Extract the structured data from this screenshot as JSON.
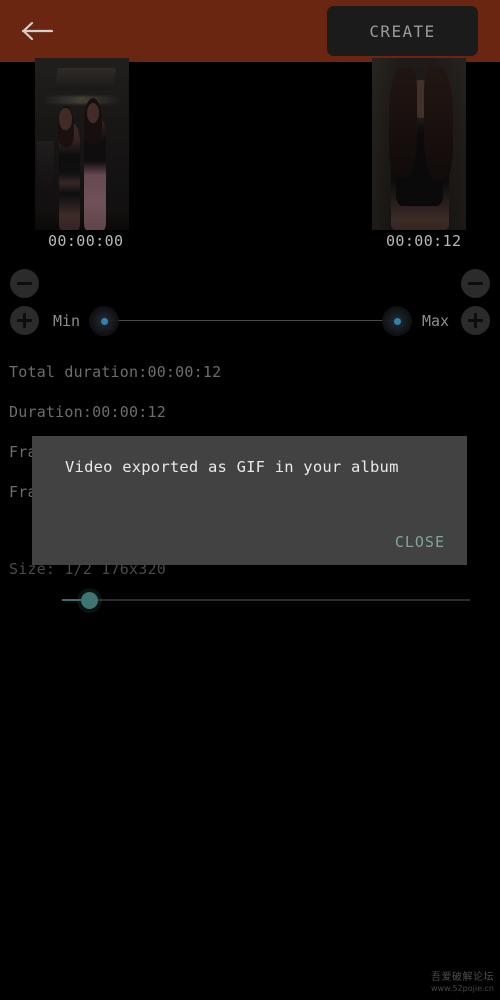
{
  "topbar": {
    "background_color": "#6a2610",
    "back_icon": "back-arrow-icon",
    "create_label": "CREATE"
  },
  "preview": {
    "start_thumbnail_alt": "gym-scene-thumbnail",
    "end_thumbnail_alt": "portrait-thumbnail",
    "start_time": "00:00:00",
    "end_time": "00:00:12"
  },
  "trim_controls": {
    "minus_left_label": "−",
    "plus_left_label": "+",
    "minus_right_label": "−",
    "plus_right_label": "+",
    "min_label": "Min",
    "max_label": "Max",
    "range_min_percent": 0,
    "range_max_percent": 100,
    "handle_color": "#2f82ad"
  },
  "info": {
    "total_duration": "Total duration:00:00:12",
    "duration": "Duration:00:00:12",
    "frame_rate_partial": "Fra",
    "frames_partial": "Fra",
    "size": "Size:  1/2  176x320"
  },
  "quality_slider": {
    "value_percent": 7,
    "accent_color": "#3d7570"
  },
  "dialog": {
    "message": "Video exported as GIF in your album",
    "close_label": "CLOSE",
    "background_color": "#424242",
    "close_color": "#83a49b"
  },
  "watermark": {
    "site_name": "吾爱破解论坛",
    "url": "www.52pojie.cn"
  }
}
